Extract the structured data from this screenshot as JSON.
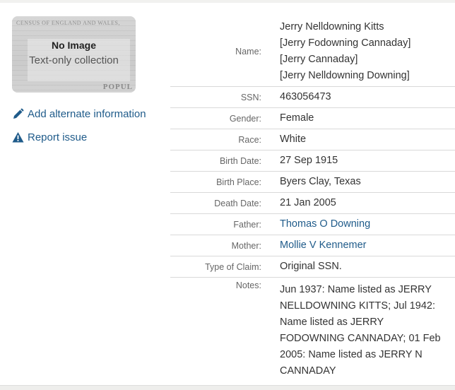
{
  "thumbnail": {
    "title": "No Image",
    "subtitle": "Text-only collection",
    "background_text": "CENSUS OF ENGLAND AND WALES,",
    "background_word": "POPUL"
  },
  "actions": {
    "add_alternate": "Add alternate information",
    "report_issue": "Report issue"
  },
  "record": {
    "name_label": "Name:",
    "names": [
      "Jerry Nelldowning Kitts",
      "[Jerry Fodowning Cannaday]",
      "[Jerry Cannaday]",
      "[Jerry Nelldowning Downing]"
    ],
    "ssn_label": "SSN:",
    "ssn": "463056473",
    "gender_label": "Gender:",
    "gender": "Female",
    "race_label": "Race:",
    "race": "White",
    "birth_date_label": "Birth Date:",
    "birth_date": "27 Sep 1915",
    "birth_place_label": "Birth Place:",
    "birth_place": "Byers Clay, Texas",
    "death_date_label": "Death Date:",
    "death_date": "21 Jan 2005",
    "father_label": "Father:",
    "father": "Thomas O Downing",
    "mother_label": "Mother:",
    "mother": "Mollie V Kennemer",
    "claim_label": "Type of Claim:",
    "claim": "Original SSN.",
    "notes_label": "Notes:",
    "notes_lines": [
      "Jun 1937: Name listed as JERRY",
      "NELLDOWNING KITTS; Jul 1942:",
      "Name listed as JERRY",
      "FODOWNING CANNADAY; 01 Feb",
      "2005: Name listed as JERRY N",
      "CANNADAY"
    ]
  },
  "colors": {
    "link": "#1f5b8a",
    "label": "#666666",
    "value": "#333333",
    "divider": "#d9d9d9"
  }
}
